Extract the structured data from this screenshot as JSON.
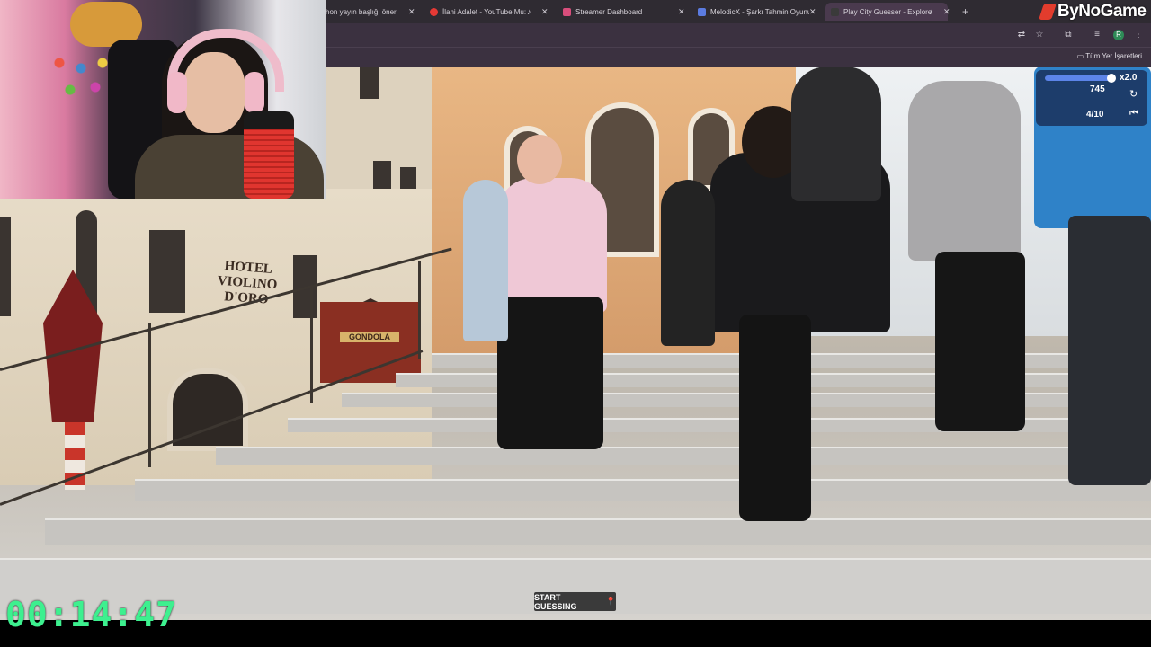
{
  "browser": {
    "tabs": [
      {
        "label": "hon yayın başlığı öneri",
        "icon": "document-icon",
        "color": "#7f7f7f"
      },
      {
        "label": "İlahi Adalet - YouTube Mu:",
        "icon": "youtube-icon",
        "color": "#e53935"
      },
      {
        "label": "Streamer Dashboard",
        "icon": "twitch-icon",
        "color": "#d94e7c"
      },
      {
        "label": "MelodicX - Şarkı Tahmin Oyunu",
        "icon": "melodicx-icon",
        "color": "#5b7be0"
      },
      {
        "label": "Play City Guesser - Explore",
        "icon": "cityguesser-icon",
        "color": "#3a3a3a"
      }
    ],
    "new_tab_label": "+",
    "bookmarks_label": "Tüm Yer İşaretleri"
  },
  "brand": {
    "name": "ByNoGame"
  },
  "scene": {
    "hotel_sign": "HOTEL VIOLINO D'ORO",
    "gondola_sign": "GONDOLA"
  },
  "hud": {
    "zoom_label": "x2.0",
    "zoom_fraction": 0.95,
    "score": "745",
    "round": "4/10"
  },
  "start_button": {
    "label": "START GUESSING"
  },
  "timer": {
    "value": "00:14:47"
  }
}
